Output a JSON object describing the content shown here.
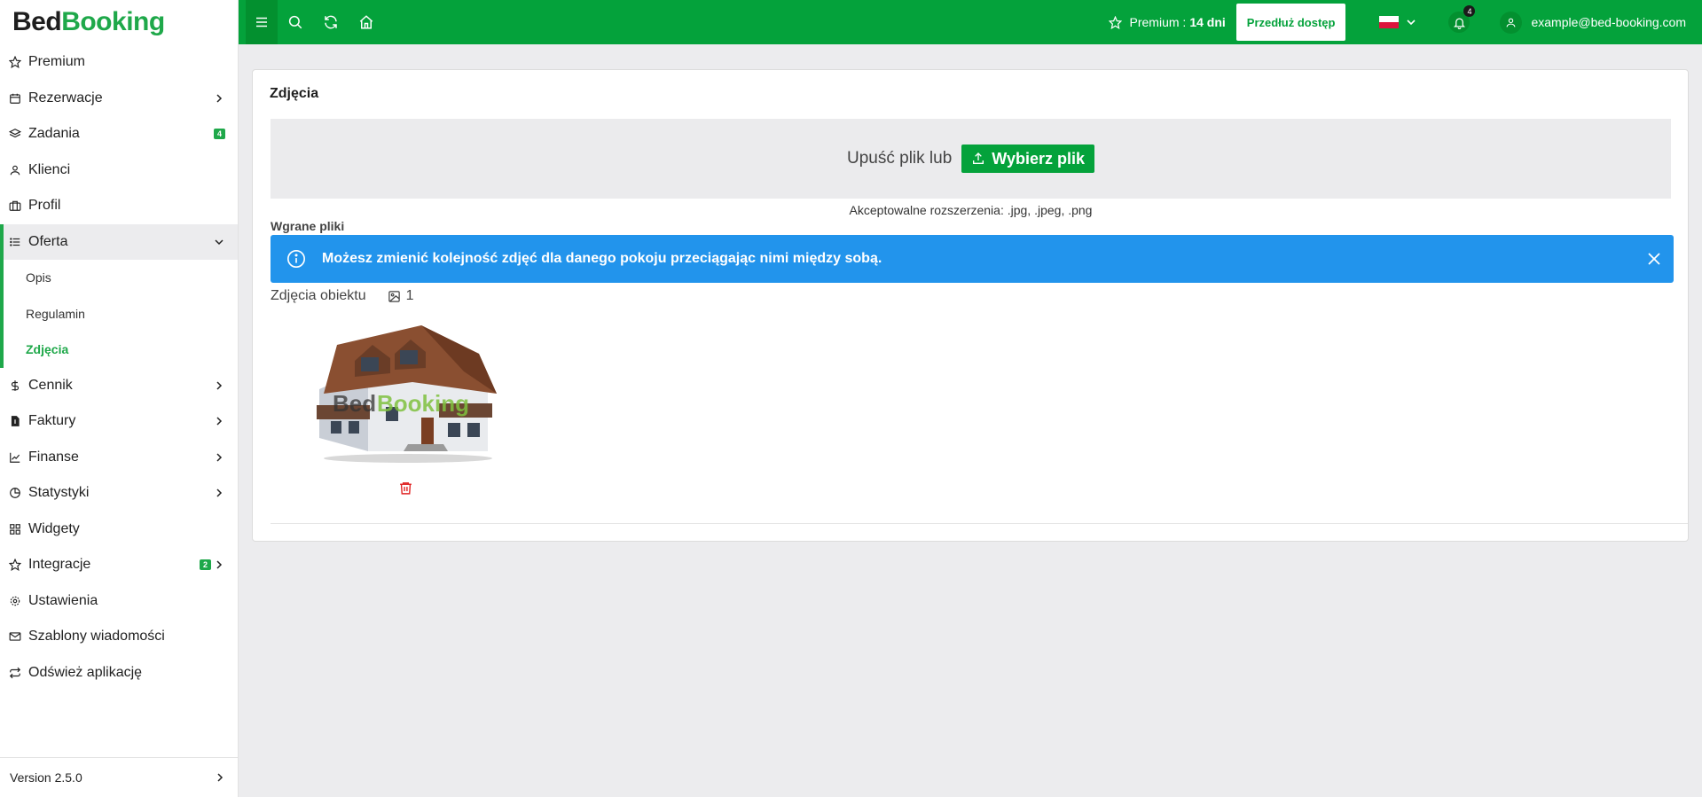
{
  "logo": {
    "part1": "Bed",
    "part2": "Booking"
  },
  "sidebar": {
    "items": [
      {
        "label": "Premium"
      },
      {
        "label": "Rezerwacje"
      },
      {
        "label": "Zadania",
        "badge": "4"
      },
      {
        "label": "Klienci"
      },
      {
        "label": "Profil"
      },
      {
        "label": "Oferta"
      },
      {
        "label": "Cennik"
      },
      {
        "label": "Faktury"
      },
      {
        "label": "Finanse"
      },
      {
        "label": "Statystyki"
      },
      {
        "label": "Widgety"
      },
      {
        "label": "Integracje",
        "badge": "2"
      },
      {
        "label": "Ustawienia"
      },
      {
        "label": "Szablony wiadomości"
      },
      {
        "label": "Odśwież aplikację"
      }
    ],
    "submenu": [
      {
        "label": "Opis"
      },
      {
        "label": "Regulamin"
      },
      {
        "label": "Zdjęcia"
      }
    ],
    "version": "Version 2.5.0"
  },
  "header": {
    "premium_label": "Premium :",
    "premium_days": "14 dni",
    "extend_button": "Przedłuż dostęp",
    "notifications_count": "4",
    "user_email": "example@bed-booking.com"
  },
  "main": {
    "title": "Zdjęcia",
    "drop_text": "Upuść plik lub",
    "choose_button": "Wybierz plik",
    "extensions": "Akceptowalne rozszerzenia: .jpg, .jpeg, .png",
    "uploaded_label": "Wgrane pliki",
    "alert": "Możesz zmienić kolejność zdjęć dla danego pokoju przeciągając nimi między sobą.",
    "photos_label": "Zdjęcia obiektu",
    "photos_count": "1",
    "watermark": {
      "part1": "Bed",
      "part2": "Booking"
    }
  },
  "colors": {
    "brand_green": "#04a23b",
    "alert_blue": "#2294ec",
    "danger_red": "#e02424"
  }
}
